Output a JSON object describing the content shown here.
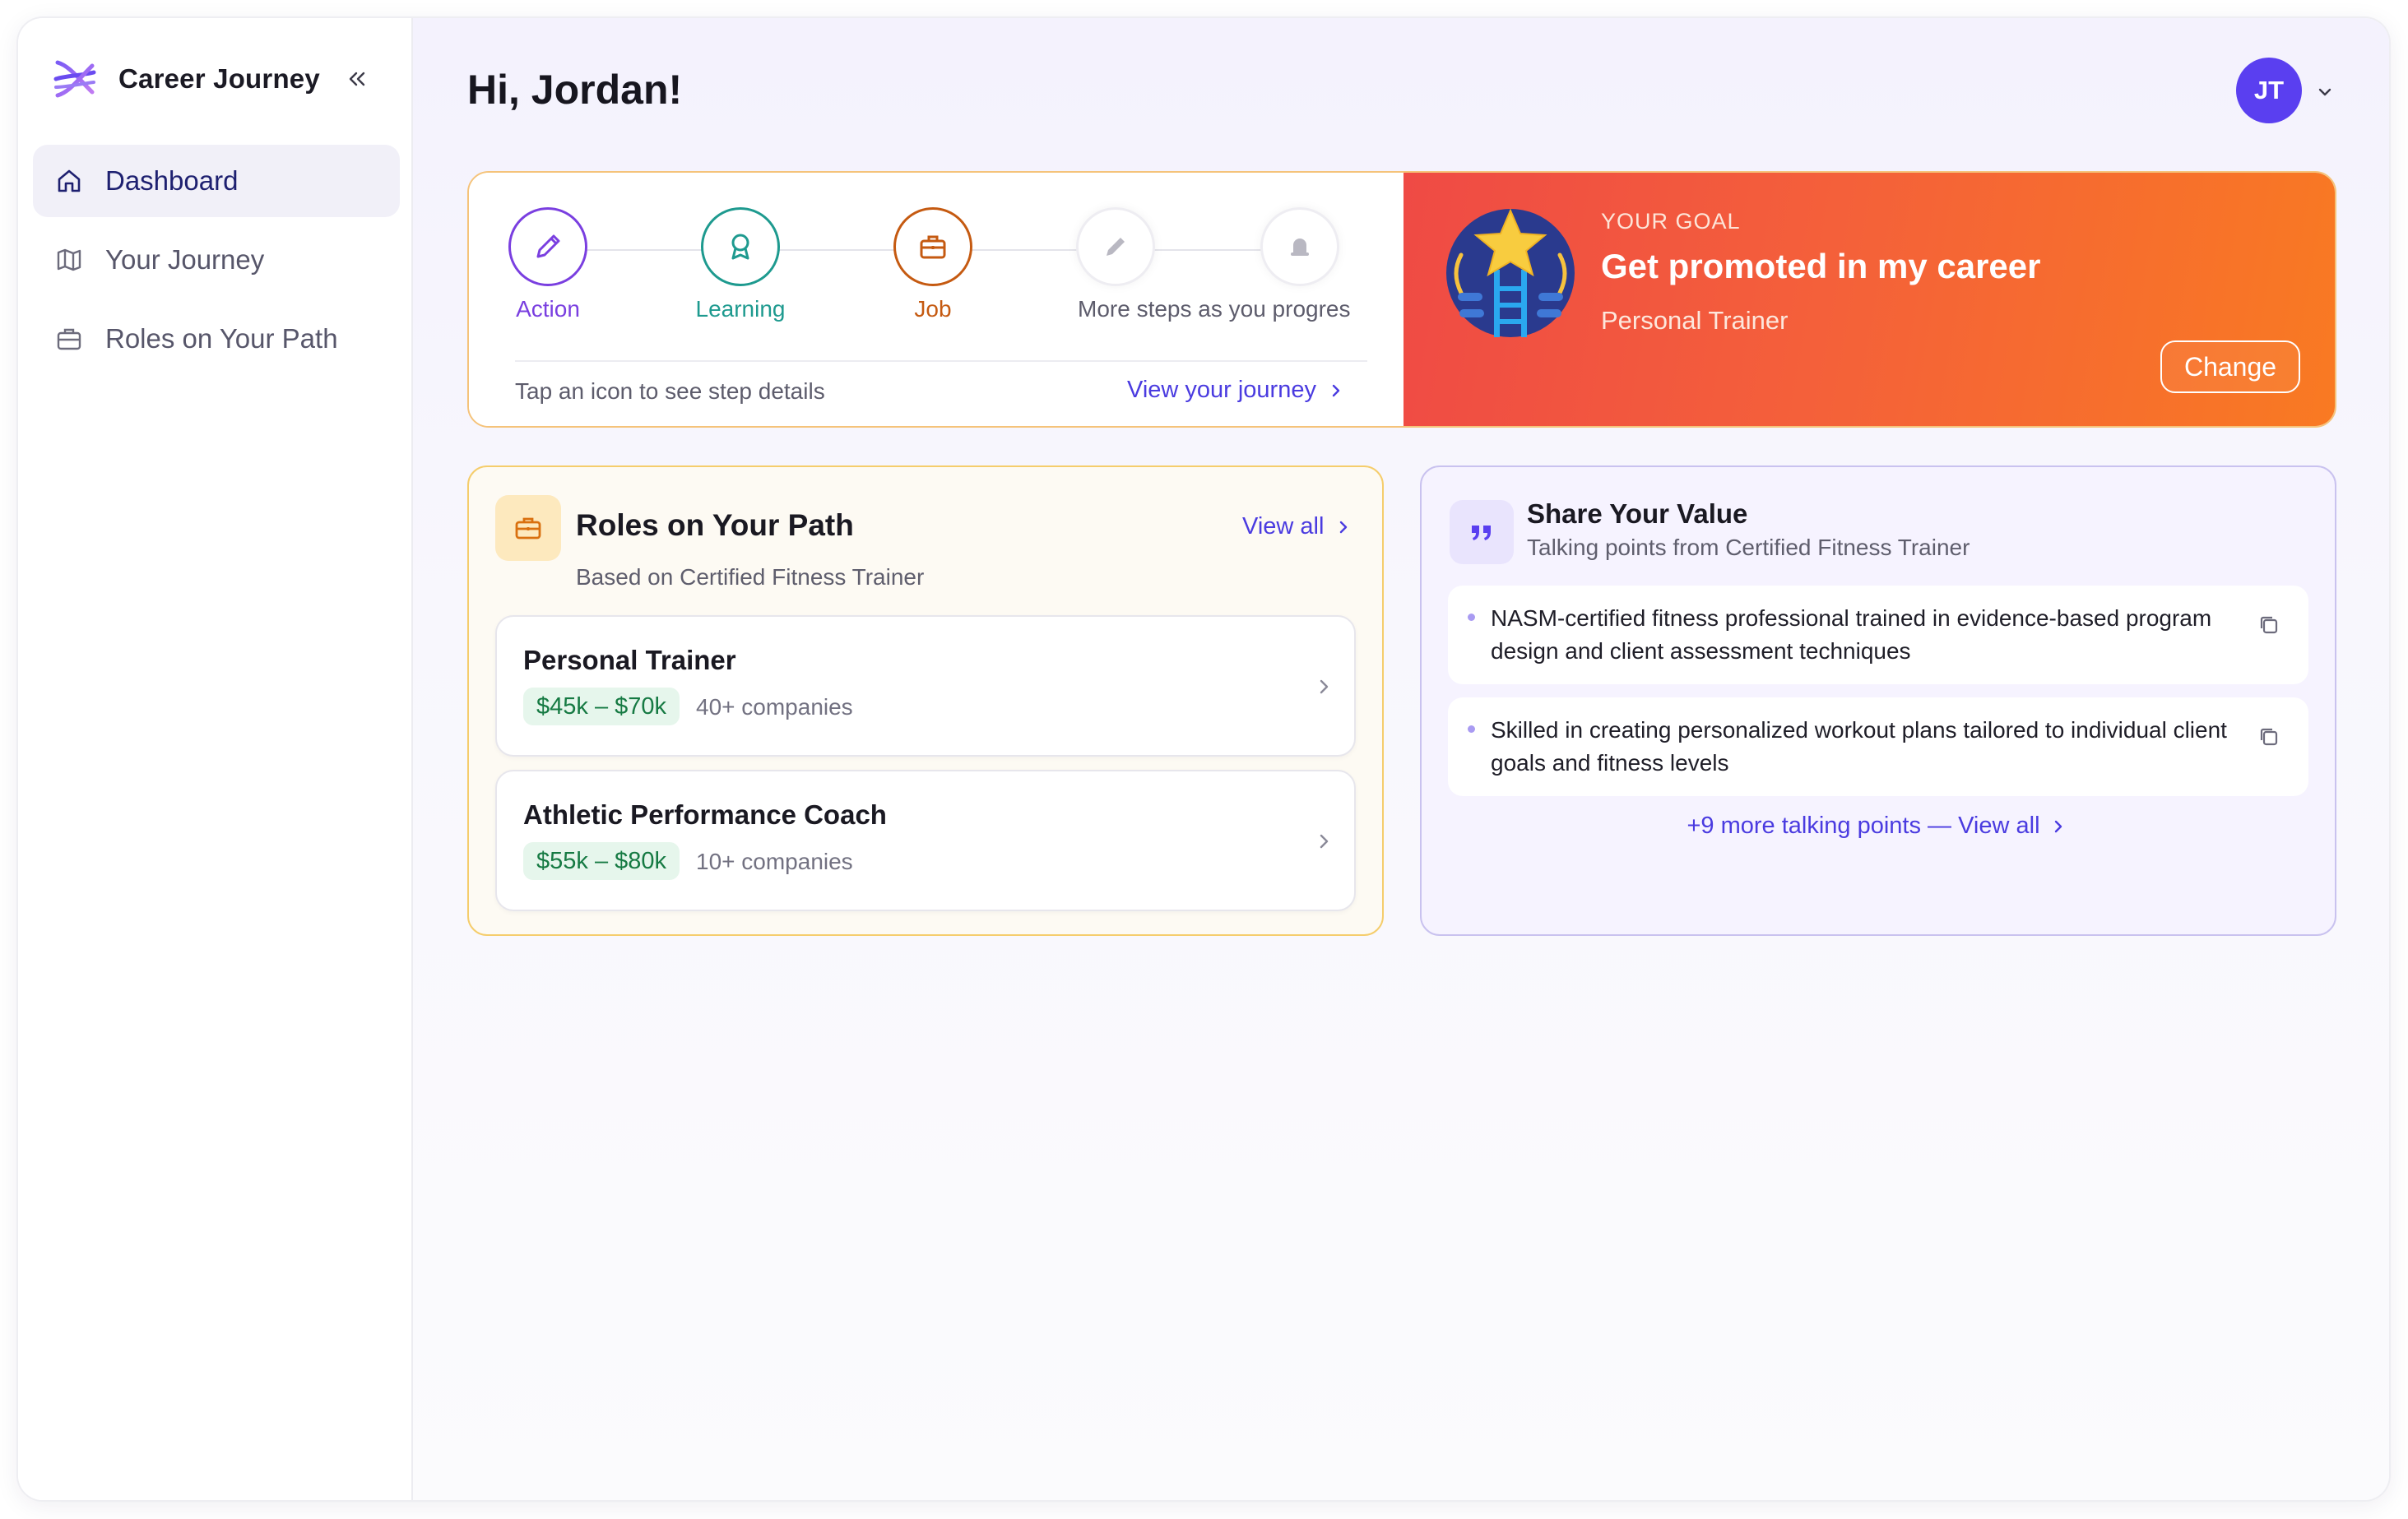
{
  "app": {
    "name": "Career Journey"
  },
  "sidebar": {
    "items": [
      {
        "label": "Dashboard",
        "icon": "home-icon",
        "active": true
      },
      {
        "label": "Your Journey",
        "icon": "map-icon",
        "active": false
      },
      {
        "label": "Roles on Your Path",
        "icon": "briefcase-icon",
        "active": false
      }
    ]
  },
  "header": {
    "greeting": "Hi, Jordan!",
    "avatar_initials": "JT"
  },
  "journey": {
    "steps": [
      {
        "label": "Action",
        "icon": "pencil-icon",
        "color": "#7a3fe0"
      },
      {
        "label": "Learning",
        "icon": "award-icon",
        "color": "#1e9a8f"
      },
      {
        "label": "Job",
        "icon": "briefcase-icon",
        "color": "#c55a11"
      },
      {
        "label": "More steps as you progres",
        "icon": "pencil-icon",
        "color": "#b9b8c2"
      },
      {
        "label": "",
        "icon": "bell-icon",
        "color": "#b9b8c2"
      }
    ],
    "hint": "Tap an icon to see step details",
    "link": "View your journey"
  },
  "goal": {
    "tag": "YOUR GOAL",
    "title": "Get promoted in my career",
    "role": "Personal Trainer",
    "change_label": "Change"
  },
  "roles": {
    "title": "Roles on Your Path",
    "subtitle": "Based on Certified Fitness Trainer",
    "view_all": "View all",
    "items": [
      {
        "name": "Personal Trainer",
        "salary": "$45k – $70k",
        "companies": "40+ companies"
      },
      {
        "name": "Athletic Performance Coach",
        "salary": "$55k – $80k",
        "companies": "10+ companies"
      }
    ]
  },
  "share": {
    "title": "Share Your Value",
    "subtitle": "Talking points from Certified Fitness Trainer",
    "points": [
      "NASM-certified fitness professional trained in evidence-based program design and client assessment techniques",
      "Skilled in creating personalized workout plans tailored to individual client goals and fitness levels"
    ],
    "more_link": "+9 more talking points — View all"
  },
  "colors": {
    "accent": "#4a3be0",
    "avatar": "#5a3ff0",
    "goal_gradient_start": "#ef4a45",
    "goal_gradient_end": "#f97a22",
    "salary_green": "#167a43"
  }
}
